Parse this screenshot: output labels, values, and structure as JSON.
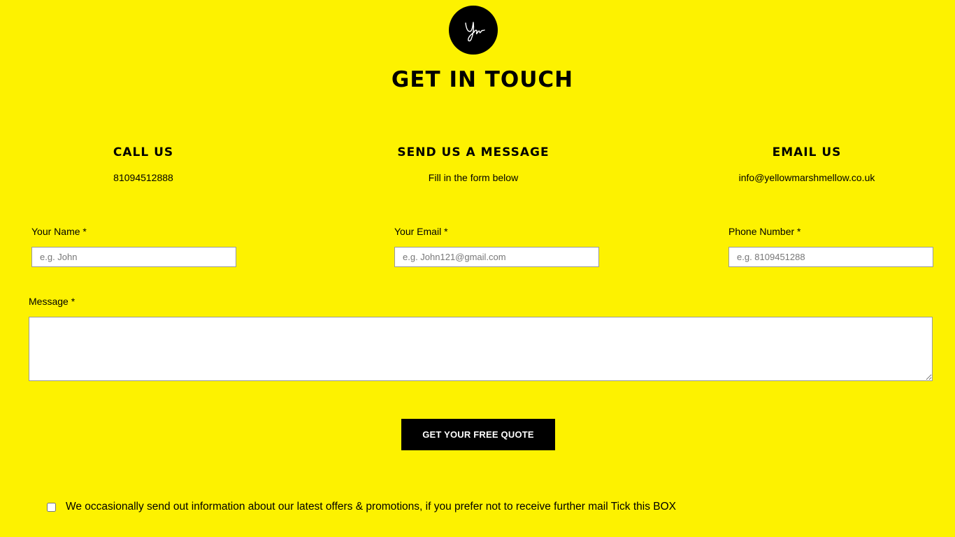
{
  "logo": {
    "icon": "signature-logo-icon",
    "colors": {
      "background": "#000000",
      "stroke": "#ffffff"
    }
  },
  "page_title": "GET IN TOUCH",
  "contact": {
    "call": {
      "heading": "CALL US",
      "value": "81094512888"
    },
    "message": {
      "heading": "SEND US A MESSAGE",
      "value": "Fill in the form below"
    },
    "email": {
      "heading": "EMAIL US",
      "value": "info@yellowmarshmellow.co.uk"
    }
  },
  "form": {
    "name": {
      "label": "Your Name *",
      "placeholder": "e.g. John",
      "value": ""
    },
    "email": {
      "label": "Your Email *",
      "placeholder": "e.g. John121@gmail.com",
      "value": ""
    },
    "phone": {
      "label": "Phone Number *",
      "placeholder": "e.g. 8109451288",
      "value": ""
    },
    "message": {
      "label": "Message *",
      "value": ""
    },
    "submit_label": "GET YOUR FREE QUOTE"
  },
  "optout": {
    "checked": false,
    "text": "We occasionally send out information about our latest offers & promotions, if you prefer not to receive further mail Tick this BOX"
  },
  "colors": {
    "background": "#fdf200",
    "button": "#000000",
    "button_text": "#ffffff"
  }
}
